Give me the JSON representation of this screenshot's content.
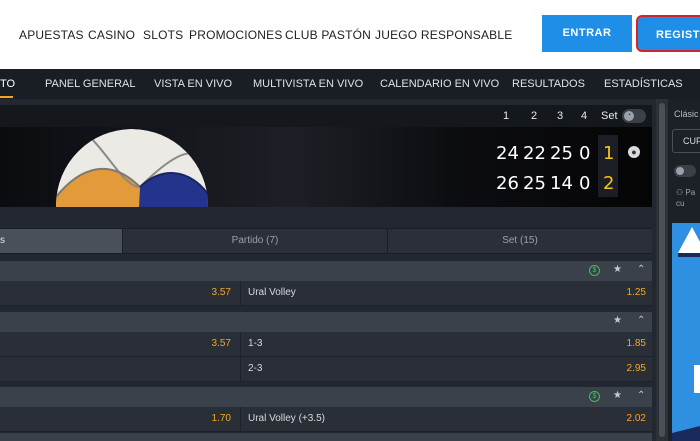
{
  "topnav": {
    "links": [
      "APUESTAS",
      "CASINO",
      "SLOTS",
      "PROMOCIONES",
      "CLUB PASTÓN",
      "JUEGO RESPONSABLE"
    ],
    "login_label": "ENTRAR",
    "register_label": "REGISTRO"
  },
  "subnav": {
    "tabs": [
      "TO",
      "PANEL GENERAL",
      "VISTA EN VIVO",
      "MULTIVISTA EN VIVO",
      "CALENDARIO EN VIVO",
      "RESULTADOS",
      "ESTADÍSTICAS"
    ]
  },
  "scoreboard": {
    "set_headers": [
      "1",
      "2",
      "3",
      "4",
      "Set"
    ],
    "team1_scores": [
      "24",
      "22",
      "25",
      "0"
    ],
    "team2_scores": [
      "26",
      "25",
      "14",
      "0"
    ],
    "team1_sets": "1",
    "team2_sets": "2"
  },
  "market_tabs": [
    "s",
    "Partido (7)",
    "Set (15)"
  ],
  "markets": [
    {
      "rows": [
        {
          "left_odd": "3.57",
          "right_name": "Ural Volley",
          "right_odd": "1.25"
        }
      ],
      "has_cashout": true
    },
    {
      "rows": [
        {
          "left_odd": "3.57",
          "right_name": "1-3",
          "right_odd": "1.85"
        },
        {
          "left_odd": "",
          "right_name": "2-3",
          "right_odd": "2.95"
        }
      ],
      "has_cashout": false
    },
    {
      "rows": [
        {
          "left_odd": "1.70",
          "right_name": "Ural Volley (+3.5)",
          "right_odd": "2.02"
        }
      ],
      "has_cashout": true
    }
  ],
  "right_panel": {
    "label": "Clásic",
    "button": "CUP",
    "note_line1": "Pa",
    "note_line2": "cu"
  },
  "icons": {
    "cashout": "dollar-icon",
    "favorite": "star-icon",
    "collapse": "chevron-up-icon",
    "sport": "volleyball-icon"
  },
  "colors": {
    "brand_blue": "#1e8ee6",
    "odds_orange": "#f3a626",
    "set_yellow": "#f5c518",
    "register_outline": "#d0262b"
  }
}
